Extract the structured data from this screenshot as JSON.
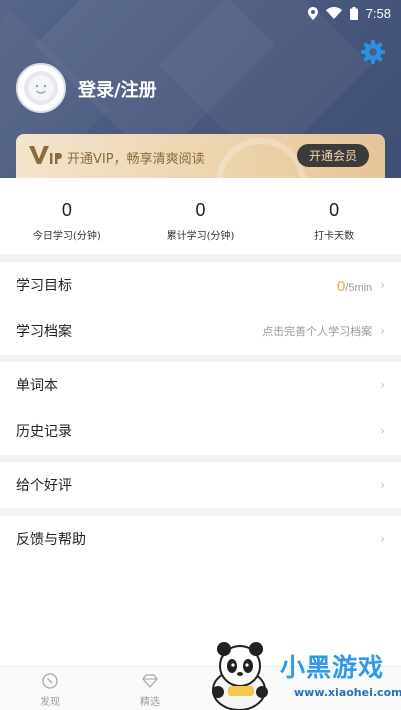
{
  "status_bar": {
    "time": "7:58"
  },
  "profile": {
    "login_label": "登录/注册"
  },
  "vip": {
    "text": "开通VIP，畅享清爽阅读",
    "button_label": "开通会员"
  },
  "stats": [
    {
      "value": "0",
      "label": "今日学习(分钟)"
    },
    {
      "value": "0",
      "label": "累计学习(分钟)"
    },
    {
      "value": "0",
      "label": "打卡天数"
    }
  ],
  "menu": {
    "goal": {
      "label": "学习目标",
      "value": "0",
      "unit": "/5min"
    },
    "archive": {
      "label": "学习档案",
      "hint": "点击完善个人学习档案"
    },
    "wordbook": {
      "label": "单词本"
    },
    "history": {
      "label": "历史记录"
    },
    "rate": {
      "label": "给个好评"
    },
    "feedback": {
      "label": "反馈与帮助"
    },
    "chevron": "›"
  },
  "tabs": [
    {
      "label": "发现",
      "icon": "compass-icon"
    },
    {
      "label": "精选",
      "icon": "diamond-icon"
    }
  ],
  "watermark": {
    "brand": "小黑游戏",
    "url": "www.xiaohei.com"
  },
  "colors": {
    "header": "#4a5a7e",
    "accent": "#e8a93c",
    "settings": "#2e8fe0",
    "vip_gold": "#ecd3ab"
  }
}
